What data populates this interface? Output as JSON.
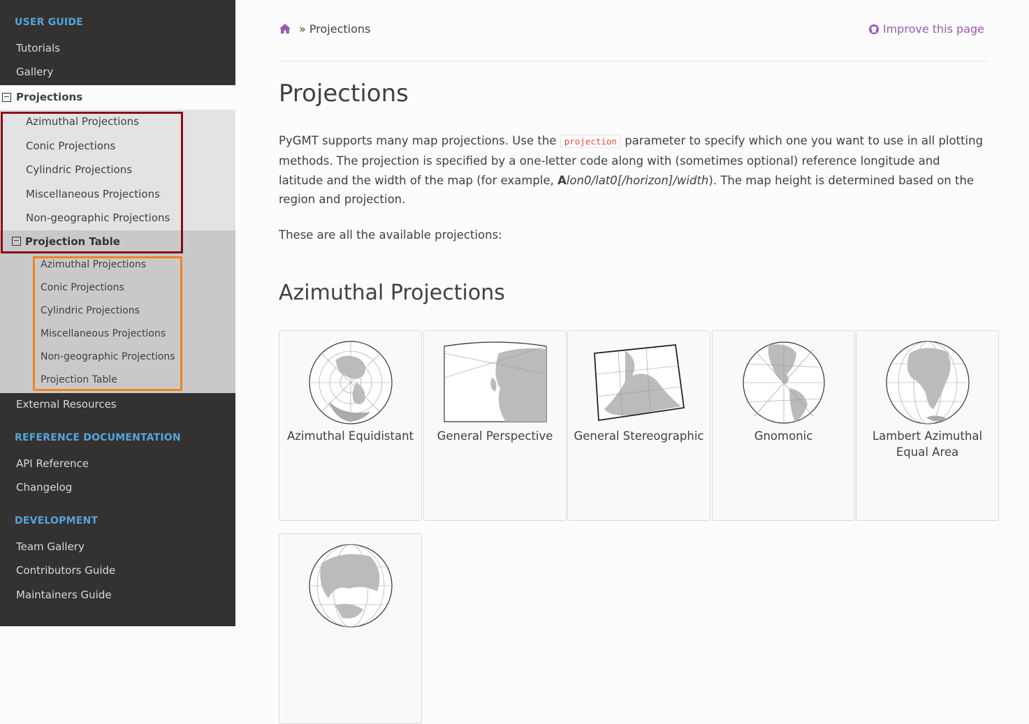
{
  "sidebar": {
    "user_guide_caption": "USER GUIDE",
    "tutorials": "Tutorials",
    "gallery": "Gallery",
    "projections": "Projections",
    "projections_children": [
      "Azimuthal Projections",
      "Conic Projections",
      "Cylindric Projections",
      "Miscellaneous Projections",
      "Non-geographic Projections"
    ],
    "projection_table": "Projection Table",
    "projection_table_children": [
      "Azimuthal Projections",
      "Conic Projections",
      "Cylindric Projections",
      "Miscellaneous Projections",
      "Non-geographic Projections",
      "Projection Table"
    ],
    "external_resources": "External Resources",
    "reference_caption": "REFERENCE DOCUMENTATION",
    "api_reference": "API Reference",
    "changelog": "Changelog",
    "development_caption": "DEVELOPMENT",
    "team_gallery": "Team Gallery",
    "contributors_guide": "Contributors Guide",
    "maintainers_guide": "Maintainers Guide"
  },
  "breadcrumb": {
    "separator": "»",
    "current": "Projections",
    "improve": "Improve this page"
  },
  "page": {
    "title": "Projections",
    "intro_1": "PyGMT supports many map projections. Use the",
    "code": "projection",
    "intro_2": "parameter to specify which one you want to use in all plotting methods. The projection is specified by a one-letter code along with (sometimes optional) reference longitude and latitude and the width of the map (for example,",
    "example_bold": "A",
    "example_italic": "lon0/lat0[/horizon]/width",
    "intro_3": "). The map height is determined based on the region and projection.",
    "available": "These are all the available projections:",
    "section_title": "Azimuthal Projections",
    "cards": [
      "Azimuthal Equidistant",
      "General Perspective",
      "General Stereographic",
      "Gnomonic",
      "Lambert Azimuthal Equal Area",
      ""
    ]
  },
  "colors": {
    "sidebar_bg": "#343131",
    "caption_blue": "#55a5d9",
    "link_purple": "#9b59b6",
    "code_red": "#e74c3c",
    "highlight_red": "#8b0a1a",
    "highlight_orange": "#f58220"
  }
}
